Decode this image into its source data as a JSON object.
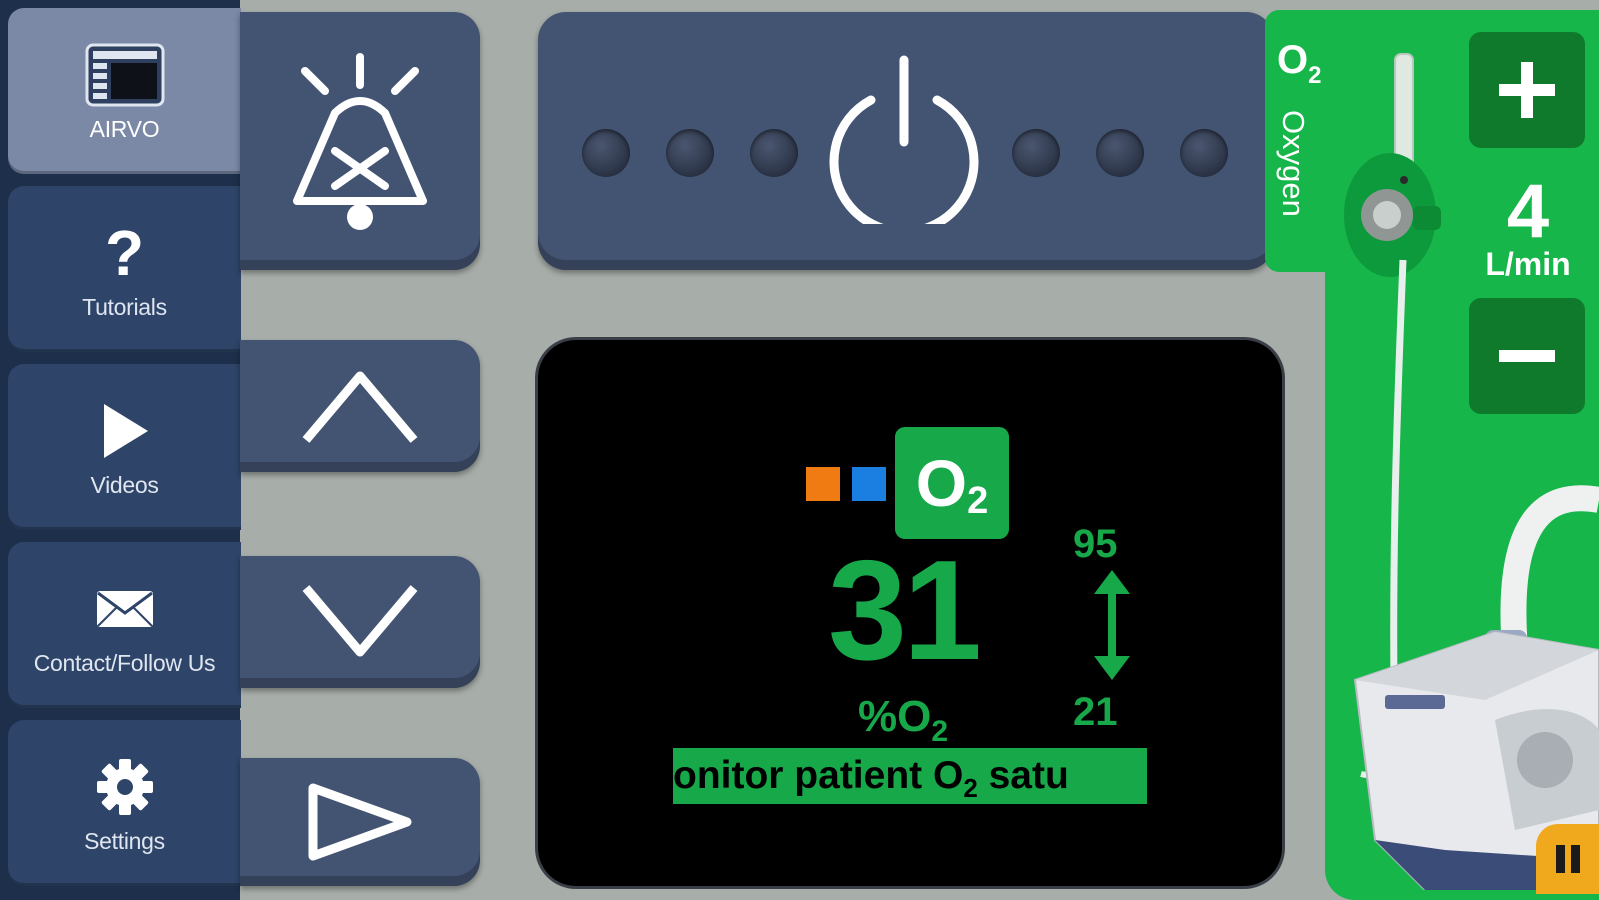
{
  "sidebar": {
    "items": [
      {
        "label": "AIRVO",
        "icon": "airvo-device-icon",
        "active": true
      },
      {
        "label": "Tutorials",
        "icon": "question-mark-icon",
        "active": false
      },
      {
        "label": "Videos",
        "icon": "play-icon",
        "active": false
      },
      {
        "label": "Contact/Follow Us",
        "icon": "envelope-icon",
        "active": false
      },
      {
        "label": "Settings",
        "icon": "gear-icon",
        "active": false
      }
    ],
    "tutorials_glyph": "?"
  },
  "controls": {
    "alarm_mute": {
      "icon": "alarm-mute-bell-icon"
    },
    "up": {
      "icon": "chevron-up-icon"
    },
    "down": {
      "icon": "chevron-down-icon"
    },
    "next": {
      "icon": "play-outline-icon"
    },
    "power": {
      "icon": "power-icon",
      "led_count": 6
    }
  },
  "display": {
    "badge_text": "O",
    "badge_sub": "2",
    "reading": "31",
    "unit_prefix": "%O",
    "unit_sub": "2",
    "limit_high": "95",
    "limit_low": "21",
    "marquee_prefix": "onitor patient O",
    "marquee_sub": "2",
    "marquee_suffix": " satu",
    "indicator_colors": [
      "#f07b12",
      "#1a7fe0"
    ]
  },
  "oxygen": {
    "label": "Oxygen",
    "mark_text": "O",
    "mark_sub": "2",
    "flow_value": "4",
    "flow_unit": "L/min",
    "increase_icon": "plus-icon",
    "decrease_icon": "minus-icon"
  },
  "pause": {
    "icon": "pause-icon"
  },
  "colors": {
    "screen_green": "#17a84a",
    "panel_green": "#16b64a",
    "button_navy": "#435473",
    "pause_orange": "#f0a81c"
  }
}
